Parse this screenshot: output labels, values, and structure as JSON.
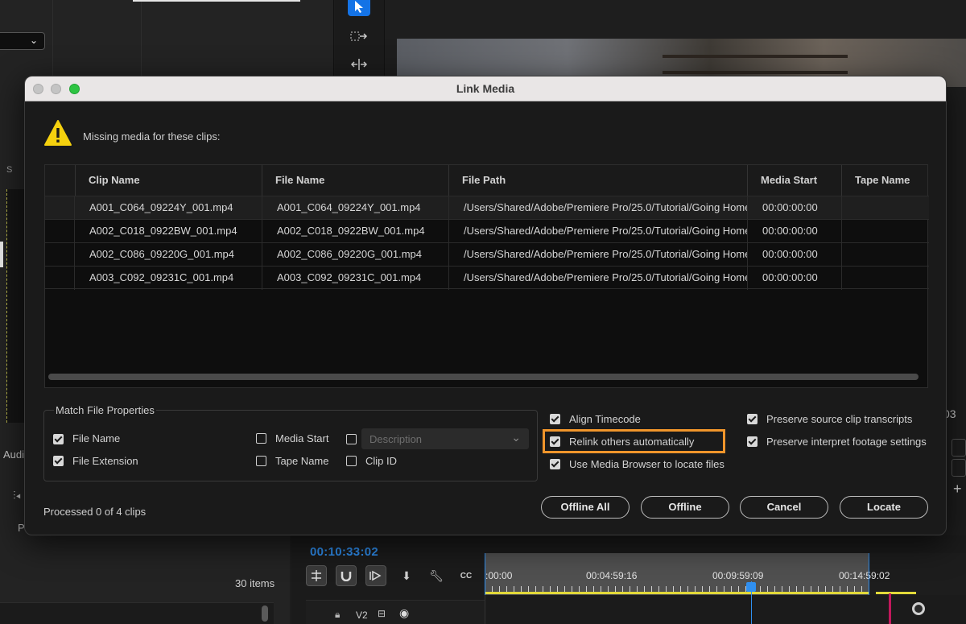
{
  "background": {
    "audio_label": "Audi",
    "panel_letter": "S",
    "program_label": "Pr",
    "items_count": "30 items",
    "right_timecode_fragment": "03",
    "timeline": {
      "timecode": "00:10:33:02",
      "ruler_labels": [
        ":00:00",
        "00:04:59:16",
        "00:09:59:09",
        "00:14:59:02"
      ],
      "track_label": "V2"
    }
  },
  "dialog": {
    "title": "Link Media",
    "warning_message": "Missing media for these clips:",
    "table": {
      "columns": [
        "Clip Name",
        "File Name",
        "File Path",
        "Media Start",
        "Tape Name"
      ],
      "rows": [
        {
          "clip": "A001_C064_09224Y_001.mp4",
          "file": "A001_C064_09224Y_001.mp4",
          "path": "/Users/Shared/Adobe/Premiere Pro/25.0/Tutorial/Going Home",
          "start": "00:00:00:00",
          "tape": ""
        },
        {
          "clip": "A002_C018_0922BW_001.mp4",
          "file": "A002_C018_0922BW_001.mp4",
          "path": "/Users/Shared/Adobe/Premiere Pro/25.0/Tutorial/Going Home",
          "start": "00:00:00:00",
          "tape": ""
        },
        {
          "clip": "A002_C086_09220G_001.mp4",
          "file": "A002_C086_09220G_001.mp4",
          "path": "/Users/Shared/Adobe/Premiere Pro/25.0/Tutorial/Going Home",
          "start": "00:00:00:00",
          "tape": ""
        },
        {
          "clip": "A003_C092_09231C_001.mp4",
          "file": "A003_C092_09231C_001.mp4",
          "path": "/Users/Shared/Adobe/Premiere Pro/25.0/Tutorial/Going Home",
          "start": "00:00:00:00",
          "tape": ""
        }
      ]
    },
    "match_file_properties": {
      "legend": "Match File Properties",
      "file_name": {
        "label": "File Name",
        "checked": true
      },
      "file_extension": {
        "label": "File Extension",
        "checked": true
      },
      "media_start": {
        "label": "Media Start",
        "checked": false
      },
      "tape_name": {
        "label": "Tape Name",
        "checked": false
      },
      "description": {
        "label": "Description",
        "checked": false
      },
      "clip_id": {
        "label": "Clip ID",
        "checked": false
      }
    },
    "options": {
      "align_timecode": {
        "label": "Align Timecode",
        "checked": true
      },
      "relink_others": {
        "label": "Relink others automatically",
        "checked": true
      },
      "use_media_browser": {
        "label": "Use Media Browser to locate files",
        "checked": true
      },
      "preserve_transcripts": {
        "label": "Preserve source clip transcripts",
        "checked": true
      },
      "preserve_interpret": {
        "label": "Preserve interpret footage settings",
        "checked": true
      }
    },
    "status": "Processed 0 of 4 clips",
    "buttons": {
      "offline_all": "Offline All",
      "offline": "Offline",
      "cancel": "Cancel",
      "locate": "Locate"
    },
    "colors": {
      "highlight": "#f0952b",
      "accent": "#1473e6",
      "timecode": "#2f8ff0"
    }
  }
}
